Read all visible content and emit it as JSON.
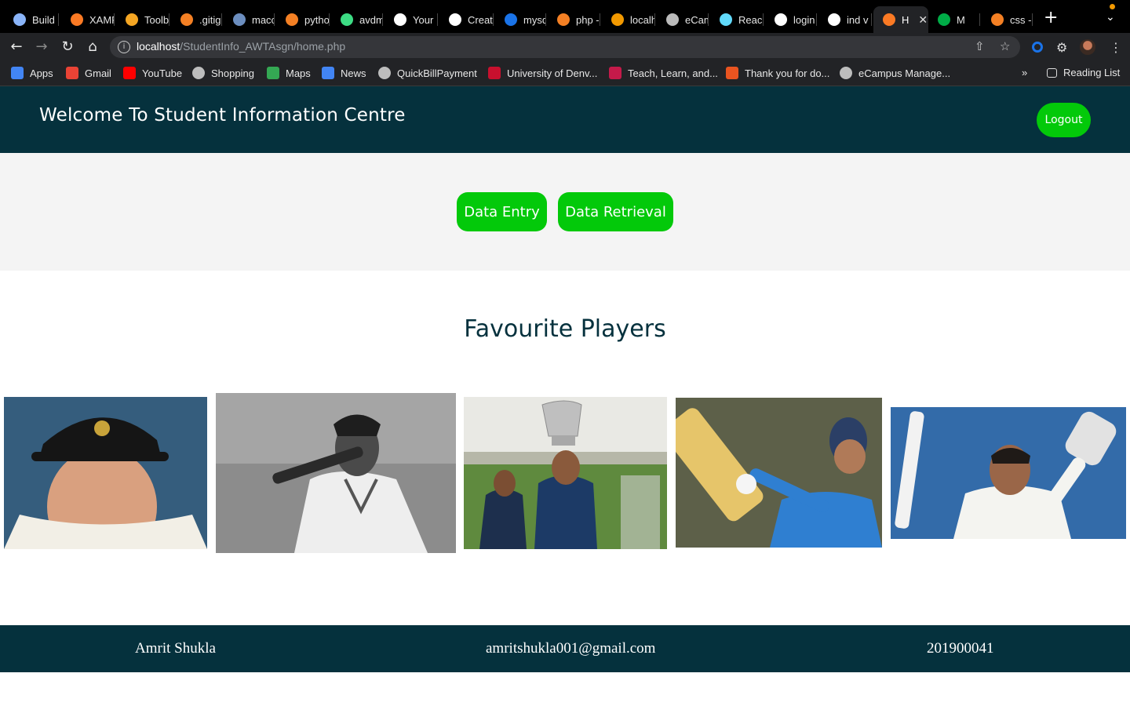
{
  "browser": {
    "tabs": [
      {
        "label": "Build",
        "icon": "globe-icon",
        "color": "#8ab4f8"
      },
      {
        "label": "XAMP",
        "icon": "xampp-icon",
        "color": "#fb7a24"
      },
      {
        "label": "Toolb",
        "icon": "shield-icon",
        "color": "#f5a623"
      },
      {
        "label": ".gitig",
        "icon": "stackoverflow-icon",
        "color": "#f48024"
      },
      {
        "label": "macc",
        "icon": "grid-icon",
        "color": "#6c8ebf"
      },
      {
        "label": "pytho",
        "icon": "stackoverflow-icon",
        "color": "#f48024"
      },
      {
        "label": "avdm",
        "icon": "android-icon",
        "color": "#3ddc84"
      },
      {
        "label": "Your",
        "icon": "github-icon",
        "color": "#ffffff"
      },
      {
        "label": "Creat",
        "icon": "github-icon",
        "color": "#ffffff"
      },
      {
        "label": "mysq",
        "icon": "database-icon",
        "color": "#1a73e8"
      },
      {
        "label": "php -",
        "icon": "stackoverflow-icon",
        "color": "#f48024"
      },
      {
        "label": "localh",
        "icon": "phpmyadmin-icon",
        "color": "#f29900"
      },
      {
        "label": "eCam",
        "icon": "globe-icon",
        "color": "#bbbbbb"
      },
      {
        "label": "Reac",
        "icon": "react-icon",
        "color": "#61dafb"
      },
      {
        "label": "login",
        "icon": "google-icon",
        "color": "#ffffff"
      },
      {
        "label": "ind v",
        "icon": "google-icon",
        "color": "#ffffff"
      },
      {
        "label": "H",
        "icon": "xampp-icon",
        "color": "#fb7a24",
        "active": true
      },
      {
        "label": "M",
        "icon": "meet-icon",
        "color": "#00ac47"
      },
      {
        "label": "css -",
        "icon": "stackoverflow-icon",
        "color": "#f48024"
      }
    ],
    "url_host": "localhost",
    "url_path": "/StudentInfo_AWTAsgn/home.php",
    "bookmarks": [
      {
        "label": "Apps",
        "icon": "apps-grid-icon"
      },
      {
        "label": "Gmail",
        "icon": "gmail-icon"
      },
      {
        "label": "YouTube",
        "icon": "youtube-icon"
      },
      {
        "label": "Shopping",
        "icon": "globe-icon"
      },
      {
        "label": "Maps",
        "icon": "maps-icon"
      },
      {
        "label": "News",
        "icon": "news-icon"
      },
      {
        "label": "QuickBillPayment",
        "icon": "globe-icon"
      },
      {
        "label": "University of Denv...",
        "icon": "university-icon"
      },
      {
        "label": "Teach, Learn, and...",
        "icon": "raspberry-icon"
      },
      {
        "label": "Thank you for do...",
        "icon": "ubuntu-icon"
      },
      {
        "label": "eCampus Manage...",
        "icon": "globe-icon"
      }
    ],
    "more_bookmarks": "»",
    "reading_list": "Reading List"
  },
  "header": {
    "title": "Welcome To Student Information Centre",
    "logout_label": "Logout"
  },
  "actions": {
    "data_entry_label": "Data Entry",
    "data_retrieval_label": "Data Retrieval"
  },
  "players": {
    "title": "Favourite Players"
  },
  "footer": {
    "name": "Amrit Shukla",
    "email": "amritshukla001@gmail.com",
    "id": "201900041"
  },
  "colors": {
    "header_bg": "#05313d",
    "accent_green": "#03c90a",
    "actions_bg": "#f4f4f4"
  }
}
